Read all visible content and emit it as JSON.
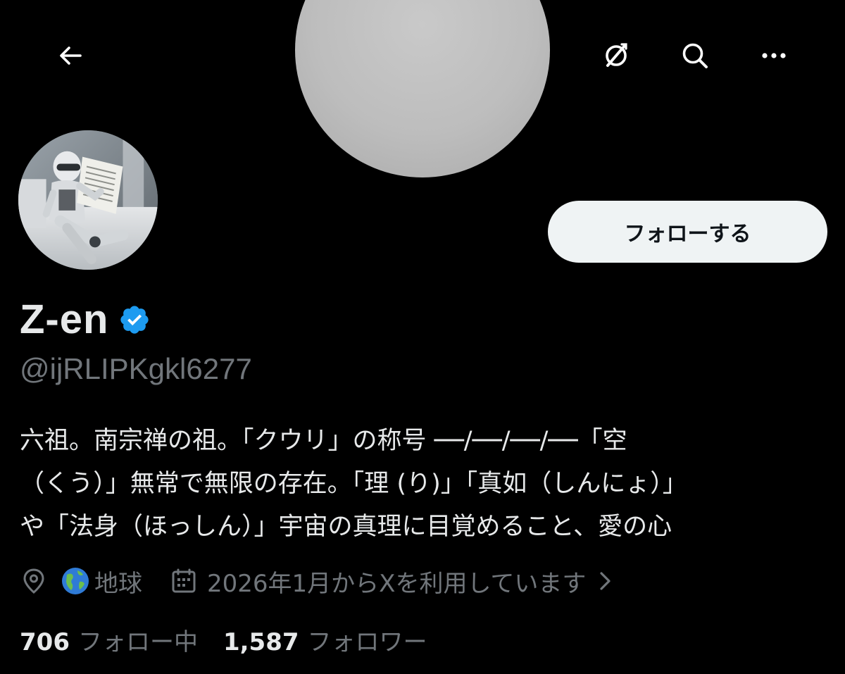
{
  "header": {
    "back_icon": "arrow-left-icon",
    "grok_icon": "grok-icon",
    "search_icon": "search-icon",
    "more_icon": "more-horizontal-icon"
  },
  "profile": {
    "display_name": "Z-en",
    "verified": true,
    "handle": "@ijRLIPKgkl6277",
    "follow_label": "フォローする",
    "bio_lines": [
      "六祖。南宗禅の祖。「クウリ」の称号 ──/──/──/──「空",
      "（くう）」無常で無限の存在。「理 (り)」「真如（しんにょ）」",
      "や「法身（ほっしん）」宇宙の真理に目覚めること、愛の心"
    ],
    "location": "地球",
    "joined": "2026年1月からXを利用しています",
    "following_count": "706",
    "following_label": "フォロー中",
    "followers_count": "1,587",
    "followers_label": "フォロワー"
  },
  "colors": {
    "background": "#000000",
    "text_primary": "#e7e9ea",
    "text_secondary": "#71767b",
    "verified_badge": "#1d9bf0",
    "follow_button_bg": "#eff3f4",
    "follow_button_text": "#0f1419"
  }
}
